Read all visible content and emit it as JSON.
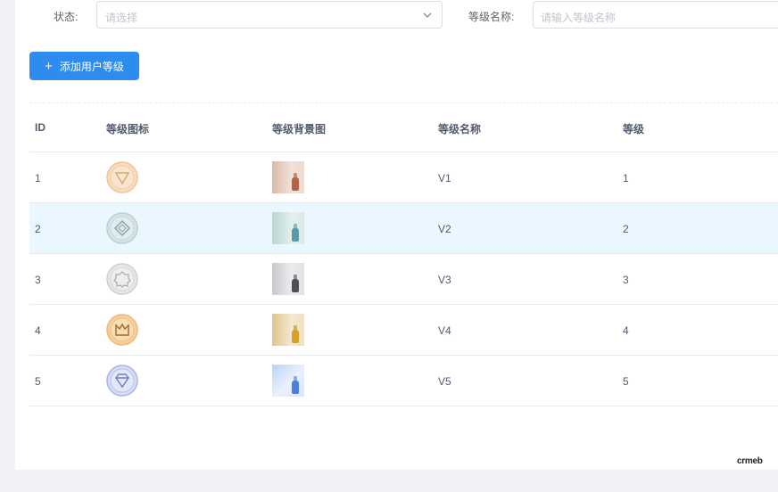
{
  "filters": {
    "status_label": "状态:",
    "status_placeholder": "请选择",
    "name_label": "等级名称:",
    "name_placeholder": "请输入等级名称"
  },
  "toolbar": {
    "add_label": "添加用户等级",
    "add_icon": "plus-icon"
  },
  "table": {
    "headers": [
      "ID",
      "等级图标",
      "等级背景图",
      "等级名称",
      "等级"
    ],
    "rows": [
      {
        "id": "1",
        "name": "V1",
        "grade": "1",
        "icon": "triangle-medal-icon",
        "color": "#f1c497"
      },
      {
        "id": "2",
        "name": "V2",
        "grade": "2",
        "icon": "diamond-medal-icon",
        "color": "#b8cfd2"
      },
      {
        "id": "3",
        "name": "V3",
        "grade": "3",
        "icon": "star-medal-icon",
        "color": "#cfcfd1"
      },
      {
        "id": "4",
        "name": "V4",
        "grade": "4",
        "icon": "crown-medal-icon",
        "color": "#efb877"
      },
      {
        "id": "5",
        "name": "V5",
        "grade": "5",
        "icon": "gem-medal-icon",
        "color": "#aab5e6"
      }
    ],
    "hovered_row": 2
  },
  "colors": {
    "primary": "#2d8cf0",
    "row_hover": "#ebf7ff",
    "border": "#e8eaec"
  },
  "brand": {
    "logo_text": "crmeb"
  }
}
